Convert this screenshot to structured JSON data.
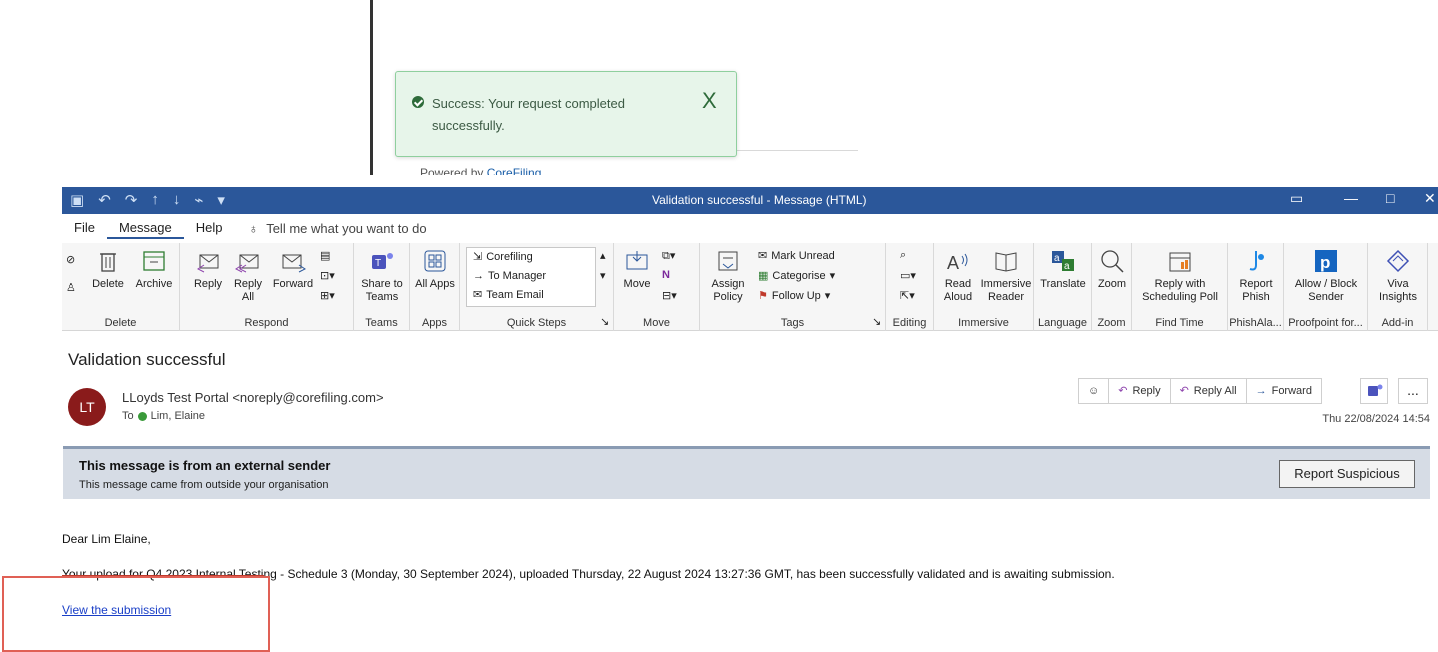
{
  "toast": {
    "message": "Success: Your request completed successfully.",
    "close_glyph": "X",
    "powered_prefix": "Powered by",
    "powered_link": "CoreFiling"
  },
  "titlebar": {
    "title": "Validation successful  -  Message (HTML)"
  },
  "menu": {
    "tabs": [
      "File",
      "Message",
      "Help"
    ],
    "active": "Message",
    "tell_me": "Tell me what you want to do"
  },
  "ribbon": {
    "groups": {
      "delete": "Delete",
      "respond": "Respond",
      "teams": "Teams",
      "apps": "Apps",
      "quick_steps": "Quick Steps",
      "move": "Move",
      "tags": "Tags",
      "editing": "Editing",
      "immersive": "Immersive",
      "language": "Language",
      "zoom": "Zoom",
      "find_time": "Find Time",
      "phishalarm": "PhishAla...",
      "proofpoint": "Proofpoint for...",
      "addin": "Add-in"
    },
    "buttons": {
      "delete": "Delete",
      "archive": "Archive",
      "reply": "Reply",
      "reply_all": "Reply All",
      "forward": "Forward",
      "share_teams": "Share to Teams",
      "all_apps": "All Apps",
      "move": "Move",
      "assign_policy": "Assign Policy",
      "mark_unread": "Mark Unread",
      "categorise": "Categorise",
      "follow_up": "Follow Up",
      "read_aloud": "Read Aloud",
      "immersive_reader": "Immersive Reader",
      "translate": "Translate",
      "zoom": "Zoom",
      "reply_poll": "Reply with Scheduling Poll",
      "report_phish": "Report Phish",
      "allow_block": "Allow / Block Sender",
      "viva": "Viva Insights"
    },
    "quick_steps": [
      "Corefiling",
      "To Manager",
      "Team Email"
    ]
  },
  "message": {
    "subject": "Validation successful",
    "avatar_initials": "LT",
    "sender": "LLoyds Test Portal <noreply@corefiling.com>",
    "to_label": "To",
    "recipient": "Lim, Elaine",
    "date": "Thu 22/08/2024 14:54",
    "actions": {
      "reply": "Reply",
      "reply_all": "Reply All",
      "forward": "Forward",
      "more": "..."
    }
  },
  "banner": {
    "title": "This message is from an external sender",
    "subtitle": "This message came from outside your organisation",
    "button": "Report Suspicious"
  },
  "body": {
    "greeting": "Dear Lim Elaine,",
    "paragraph": "Your upload for Q4 2023 Internal Testing - Schedule 3 (Monday, 30 September 2024), uploaded Thursday, 22 August 2024 13:27:36 GMT, has been successfully validated and is awaiting submission.",
    "link": "View the submission"
  }
}
